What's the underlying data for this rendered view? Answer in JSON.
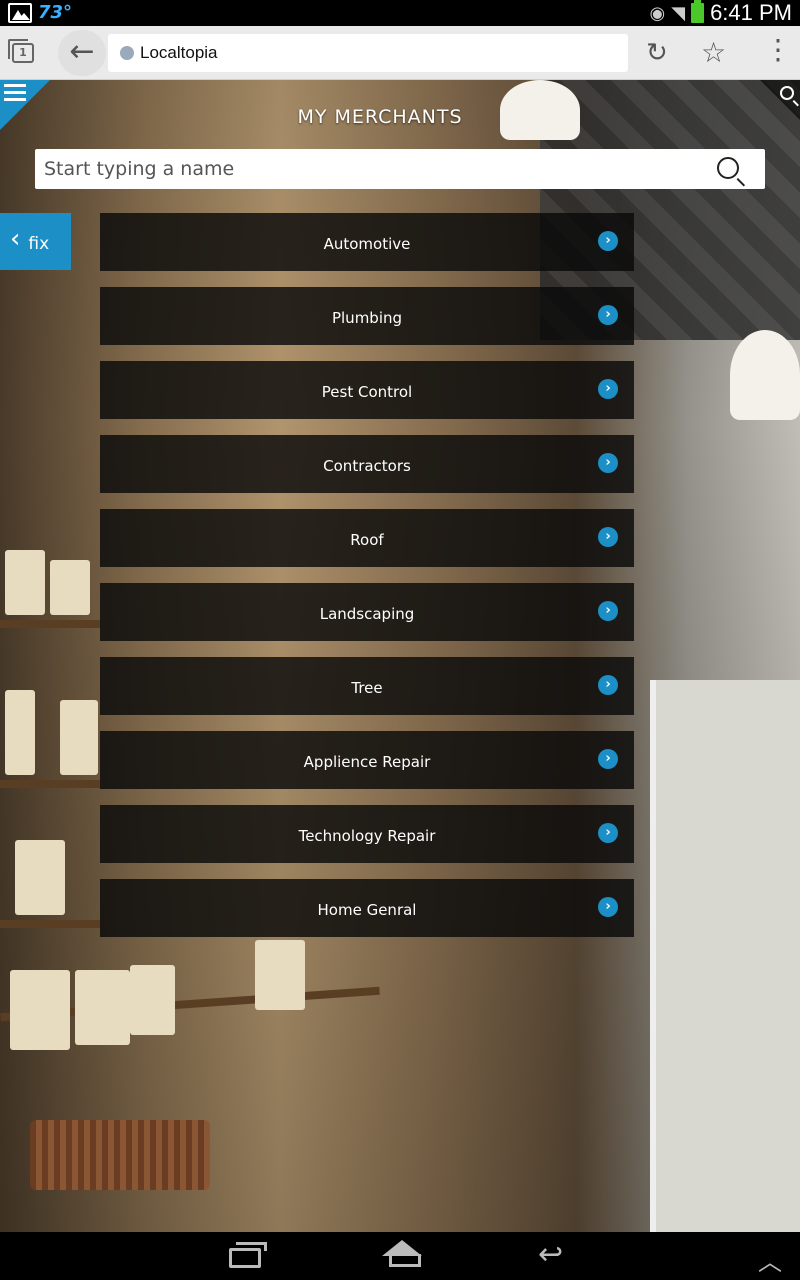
{
  "status_bar": {
    "temperature": "73°",
    "time": "6:41 PM"
  },
  "browser": {
    "tab_count": "1",
    "url_title": "Localtopia"
  },
  "page": {
    "title": "MY MERCHANTS",
    "search": {
      "placeholder": "Start typing a name"
    },
    "fix_button": {
      "label": "fix"
    },
    "categories": [
      {
        "label": "Automotive"
      },
      {
        "label": "Plumbing"
      },
      {
        "label": "Pest Control"
      },
      {
        "label": "Contractors"
      },
      {
        "label": "Roof"
      },
      {
        "label": "Landscaping"
      },
      {
        "label": "Tree"
      },
      {
        "label": "Applience Repair"
      },
      {
        "label": "Technology Repair"
      },
      {
        "label": "Home Genral"
      }
    ]
  },
  "colors": {
    "accent": "#1b8fc6",
    "category_bg": "#0a0a0a",
    "battery": "#4ac82a",
    "weather": "#3ab0ff"
  },
  "icons": [
    "picture-icon",
    "eye-icon",
    "wifi-icon",
    "battery-icon",
    "tabs-icon",
    "back-arrow-icon",
    "reload-icon",
    "star-icon",
    "overflow-menu-icon",
    "hamburger-icon",
    "search-icon",
    "chevron-left-icon",
    "chevron-right-icon",
    "recent-apps-icon",
    "home-icon",
    "back-nav-icon",
    "up-icon"
  ]
}
